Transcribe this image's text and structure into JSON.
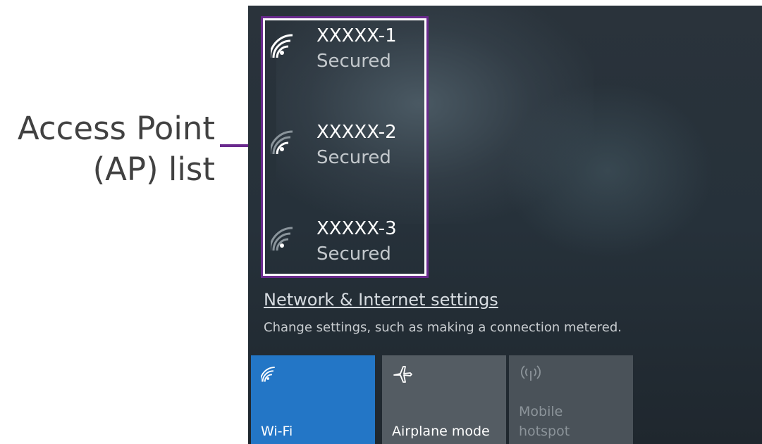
{
  "callout": {
    "line1": "Access Point",
    "line2": "(AP) list",
    "accent_color": "#6a2a8e"
  },
  "access_points": [
    {
      "name": "XXXXX-1",
      "status": "Secured",
      "signal_icon": "wifi-signal-icon",
      "signal_bars": 4
    },
    {
      "name": "XXXXX-2",
      "status": "Secured",
      "signal_icon": "wifi-signal-icon",
      "signal_bars": 2
    },
    {
      "name": "XXXXX-3",
      "status": "Secured",
      "signal_icon": "wifi-signal-icon",
      "signal_bars": 1
    }
  ],
  "settings": {
    "link_text": "Network & Internet settings",
    "description": "Change settings, such as making a connection metered."
  },
  "quick_actions": [
    {
      "label": "Wi-Fi",
      "icon": "wifi-icon",
      "state": "on",
      "color": "#2376c6"
    },
    {
      "label": "Airplane mode",
      "icon": "airplane-icon",
      "state": "off",
      "color": "#545c63"
    },
    {
      "label": "Mobile\nhotspot",
      "icon": "mobile-hotspot-icon",
      "state": "disabled",
      "color": "#4a5259"
    }
  ]
}
